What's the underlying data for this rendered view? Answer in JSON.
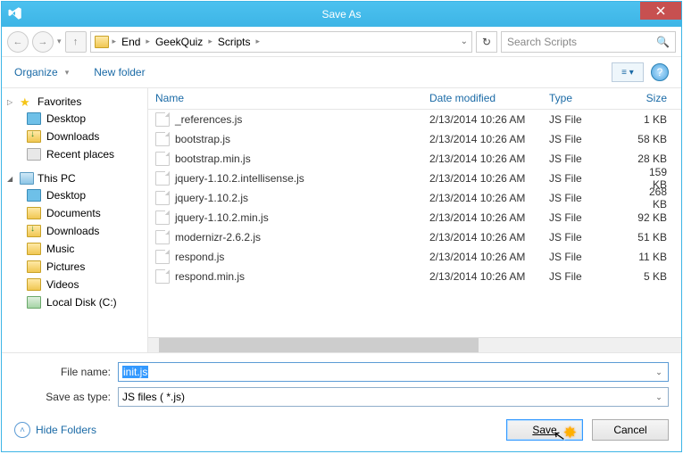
{
  "title": "Save As",
  "breadcrumbs": [
    "End",
    "GeekQuiz",
    "Scripts"
  ],
  "search_placeholder": "Search Scripts",
  "toolbar": {
    "organize": "Organize",
    "newfolder": "New folder"
  },
  "sidebar": {
    "favorites": {
      "label": "Favorites",
      "items": [
        "Desktop",
        "Downloads",
        "Recent places"
      ]
    },
    "thispc": {
      "label": "This PC",
      "items": [
        "Desktop",
        "Documents",
        "Downloads",
        "Music",
        "Pictures",
        "Videos",
        "Local Disk (C:)"
      ]
    }
  },
  "columns": {
    "name": "Name",
    "date": "Date modified",
    "type": "Type",
    "size": "Size"
  },
  "files": [
    {
      "name": "_references.js",
      "date": "2/13/2014 10:26 AM",
      "type": "JS File",
      "size": "1 KB"
    },
    {
      "name": "bootstrap.js",
      "date": "2/13/2014 10:26 AM",
      "type": "JS File",
      "size": "58 KB"
    },
    {
      "name": "bootstrap.min.js",
      "date": "2/13/2014 10:26 AM",
      "type": "JS File",
      "size": "28 KB"
    },
    {
      "name": "jquery-1.10.2.intellisense.js",
      "date": "2/13/2014 10:26 AM",
      "type": "JS File",
      "size": "159 KB"
    },
    {
      "name": "jquery-1.10.2.js",
      "date": "2/13/2014 10:26 AM",
      "type": "JS File",
      "size": "268 KB"
    },
    {
      "name": "jquery-1.10.2.min.js",
      "date": "2/13/2014 10:26 AM",
      "type": "JS File",
      "size": "92 KB"
    },
    {
      "name": "modernizr-2.6.2.js",
      "date": "2/13/2014 10:26 AM",
      "type": "JS File",
      "size": "51 KB"
    },
    {
      "name": "respond.js",
      "date": "2/13/2014 10:26 AM",
      "type": "JS File",
      "size": "11 KB"
    },
    {
      "name": "respond.min.js",
      "date": "2/13/2014 10:26 AM",
      "type": "JS File",
      "size": "5 KB"
    }
  ],
  "form": {
    "filename_label": "File name:",
    "filename_value": "init.js",
    "type_label": "Save as type:",
    "type_value": "JS files  ( *.js)"
  },
  "actions": {
    "hide": "Hide Folders",
    "save": "Save",
    "cancel": "Cancel"
  }
}
